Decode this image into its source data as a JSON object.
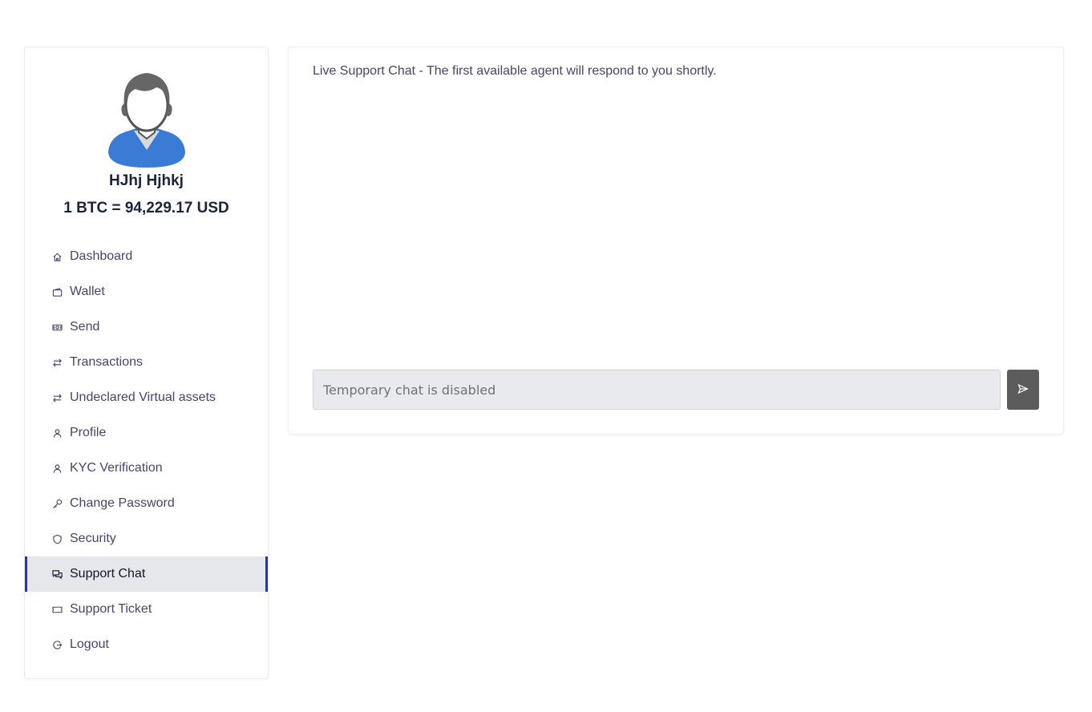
{
  "user": {
    "name": "HJhj Hjhkj",
    "btc_rate": "1 BTC = 94,229.17 USD"
  },
  "sidebar": {
    "items": [
      {
        "label": "Dashboard",
        "icon": "home-icon",
        "active": false
      },
      {
        "label": "Wallet",
        "icon": "wallet-icon",
        "active": false
      },
      {
        "label": "Send",
        "icon": "cash-icon",
        "active": false
      },
      {
        "label": "Transactions",
        "icon": "arrows-exchange-icon",
        "active": false
      },
      {
        "label": "Undeclared Virtual assets",
        "icon": "arrows-exchange-icon",
        "active": false
      },
      {
        "label": "Profile",
        "icon": "user-icon",
        "active": false
      },
      {
        "label": "KYC Verification",
        "icon": "user-icon",
        "active": false
      },
      {
        "label": "Change Password",
        "icon": "key-icon",
        "active": false
      },
      {
        "label": "Security",
        "icon": "shield-icon",
        "active": false
      },
      {
        "label": "Support Chat",
        "icon": "chat-icon",
        "active": true
      },
      {
        "label": "Support Ticket",
        "icon": "ticket-icon",
        "active": false
      },
      {
        "label": "Logout",
        "icon": "logout-icon",
        "active": false
      }
    ]
  },
  "chat": {
    "header": "Live Support Chat - The first available agent will respond to you shortly.",
    "input_placeholder": "Temporary chat is disabled",
    "send_icon": "send-icon"
  },
  "colors": {
    "active_border": "#1e35c7",
    "active_bg": "#e6e7eb",
    "nav_text": "#4a4370",
    "avatar_shirt": "#3a7bd5",
    "avatar_hair": "#666666",
    "send_button": "#5c5c5c"
  }
}
